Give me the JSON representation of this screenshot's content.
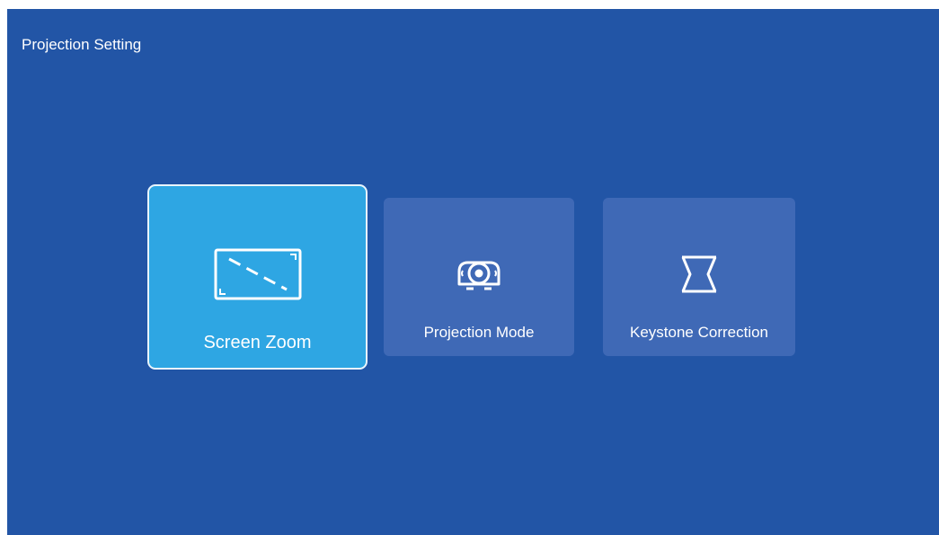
{
  "header": {
    "title": "Projection Setting"
  },
  "menu": {
    "items": [
      {
        "label": "Screen Zoom",
        "icon": "screen-zoom-icon",
        "selected": true
      },
      {
        "label": "Projection Mode",
        "icon": "projector-icon",
        "selected": false
      },
      {
        "label": "Keystone Correction",
        "icon": "keystone-icon",
        "selected": false
      }
    ]
  },
  "colors": {
    "background": "#2255a6",
    "card": "#3f69b6",
    "card_selected": "#2ea6e3",
    "text": "#ffffff"
  }
}
